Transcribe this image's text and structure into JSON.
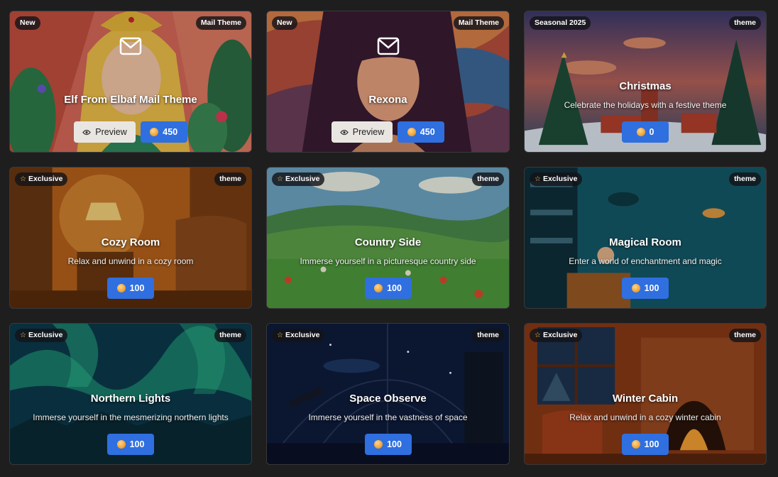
{
  "cards": [
    {
      "title": "Elf From Elbaf Mail Theme",
      "badge_left": "New",
      "badge_right": "Mail Theme",
      "preview_label": "Preview",
      "price": "450",
      "icon": "mail-icon"
    },
    {
      "title": "Rexona",
      "badge_left": "New",
      "badge_right": "Mail Theme",
      "preview_label": "Preview",
      "price": "450",
      "icon": "mail-icon"
    },
    {
      "title": "Christmas",
      "badge_left": "Seasonal 2025",
      "badge_right": "theme",
      "description": "Celebrate the holidays with a festive theme",
      "price": "0"
    },
    {
      "title": "Cozy Room",
      "badge_left": "Exclusive",
      "badge_right": "theme",
      "description": "Relax and unwind in a cozy room",
      "price": "100"
    },
    {
      "title": "Country Side",
      "badge_left": "Exclusive",
      "badge_right": "theme",
      "description": "Immerse yourself in a picturesque country side",
      "price": "100"
    },
    {
      "title": "Magical Room",
      "badge_left": "Exclusive",
      "badge_right": "theme",
      "description": "Enter a world of enchantment and magic",
      "price": "100"
    },
    {
      "title": "Northern Lights",
      "badge_left": "Exclusive",
      "badge_right": "theme",
      "description": "Immerse yourself in the mesmerizing northern lights",
      "price": "100"
    },
    {
      "title": "Space Observe",
      "badge_left": "Exclusive",
      "badge_right": "theme",
      "description": "Immerse yourself in the vastness of space",
      "price": "100"
    },
    {
      "title": "Winter Cabin",
      "badge_left": "Exclusive",
      "badge_right": "theme",
      "description": "Relax and unwind in a cozy winter cabin",
      "price": "100"
    }
  ],
  "icons": {
    "exclusive_badge": "star-icon",
    "price": "coin-icon",
    "preview": "eye-icon"
  },
  "colors": {
    "price_button": "#2f6fe0",
    "preview_button": "#e9e6e2",
    "background": "#1e1e1f"
  }
}
